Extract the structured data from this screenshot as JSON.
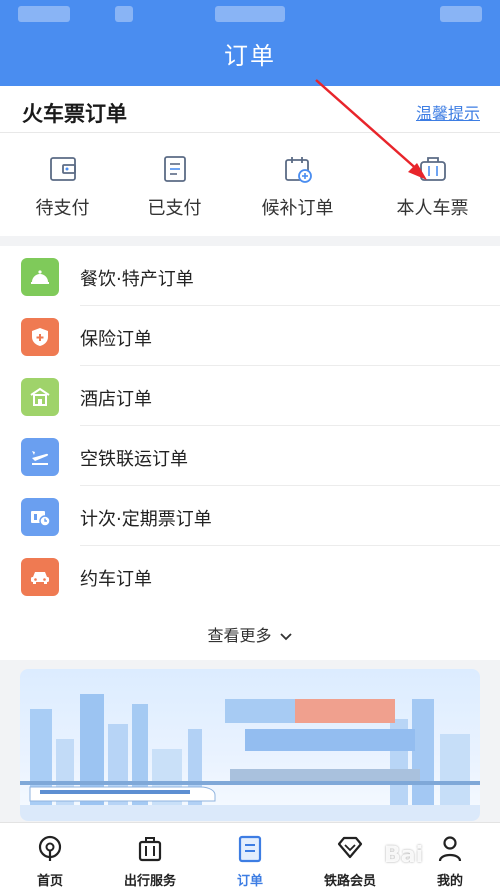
{
  "header": {
    "title": "订单"
  },
  "card": {
    "title": "火车票订单",
    "tip": "温馨提示",
    "quick": [
      {
        "label": "待支付",
        "icon": "wallet-icon"
      },
      {
        "label": "已支付",
        "icon": "receipt-icon"
      },
      {
        "label": "候补订单",
        "icon": "calendar-add-icon"
      },
      {
        "label": "本人车票",
        "icon": "luggage-icon"
      }
    ]
  },
  "list": {
    "items": [
      {
        "label": "餐饮·特产订单",
        "icon": "food-cloche-icon",
        "color": "#7fca5a"
      },
      {
        "label": "保险订单",
        "icon": "shield-plus-icon",
        "color": "#ef7a52"
      },
      {
        "label": "酒店订单",
        "icon": "hotel-icon",
        "color": "#9fd36a"
      },
      {
        "label": "空铁联运订单",
        "icon": "plane-train-icon",
        "color": "#6a9ff0"
      },
      {
        "label": "计次·定期票订单",
        "icon": "ticket-clock-icon",
        "color": "#6a9ff0"
      },
      {
        "label": "约车订单",
        "icon": "car-icon",
        "color": "#ef7a52"
      }
    ],
    "more": "查看更多"
  },
  "tabbar": {
    "items": [
      {
        "label": "首页",
        "icon": "home-icon"
      },
      {
        "label": "出行服务",
        "icon": "suitcase-icon"
      },
      {
        "label": "订单",
        "icon": "order-icon",
        "active": true
      },
      {
        "label": "铁路会员",
        "icon": "diamond-icon"
      },
      {
        "label": "我的",
        "icon": "user-icon"
      }
    ]
  },
  "watermark": "Bai",
  "colors": {
    "brand": "#4a8df0",
    "link": "#3d7de3",
    "arrow": "#e8252b"
  }
}
